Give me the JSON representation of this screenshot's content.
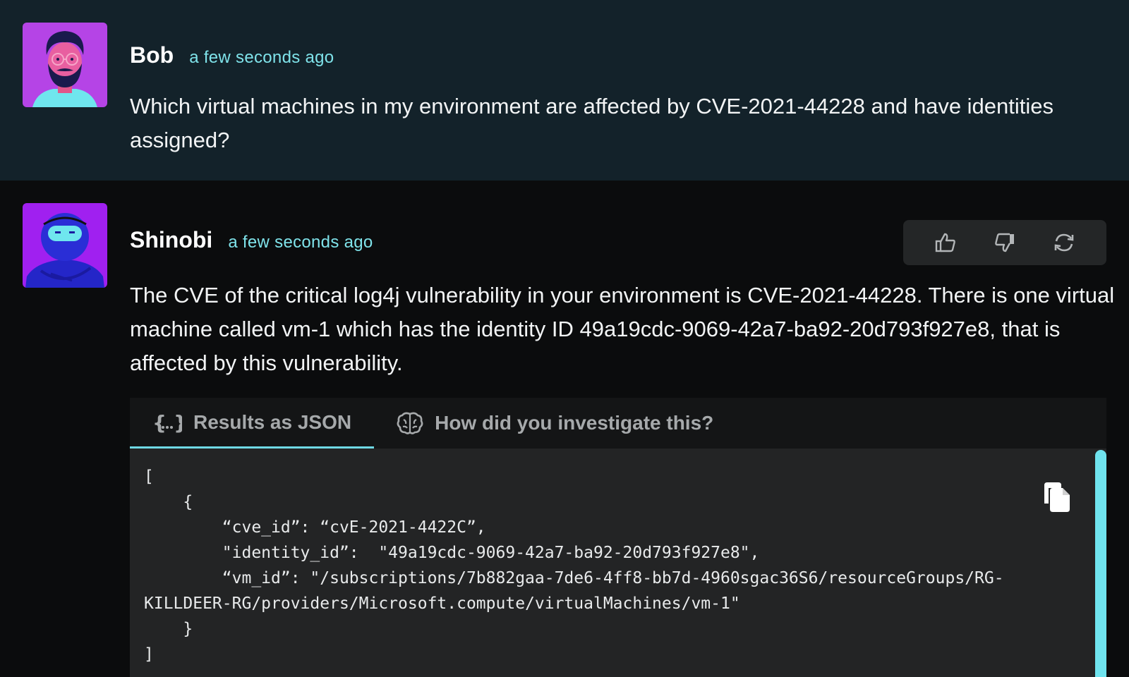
{
  "user_message": {
    "author": "Bob",
    "timestamp": "a few seconds ago",
    "text": "Which virtual machines in my environment are affected by CVE-2021-44228 and have identities assigned?",
    "avatar_icon": "bearded-man-avatar"
  },
  "bot_message": {
    "author": "Shinobi",
    "timestamp": "a few seconds ago",
    "text": "The CVE of the critical log4j vulnerability in your environment is CVE-2021-44228. There is one virtual machine called vm-1 which has the identity ID 49a19cdc-9069-42a7-ba92-20d793f927e8, that is affected by this vulnerability.",
    "avatar_icon": "ninja-avatar",
    "actions": [
      "thumbs-up-icon",
      "thumbs-down-icon",
      "refresh-icon"
    ]
  },
  "tabs": [
    {
      "label": "Results as JSON",
      "icon": "json-braces-icon",
      "active": true
    },
    {
      "label": "How did you investigate this?",
      "icon": "brain-icon",
      "active": false
    }
  ],
  "code": {
    "lines": [
      "[",
      "    {",
      "        “cve_id”: “cvE-2021-4422C”,",
      "        \"identity_id”:  \"49a19cdc-9069-42a7-ba92-20d793f927e8\",",
      "        “vm_id”: \"/subscriptions/7b882gaa-7de6-4ff8-bb7d-4960sgac36S6/resourceGroups/RG-",
      "KILLDEER-RG/providers/Microsoft.compute/virtualMachines/vm-1\"",
      "    }",
      "]"
    ]
  },
  "colors": {
    "user_bg": "#13222a",
    "bot_bg": "#0b0c0d",
    "accent": "#6fd8e4",
    "timestamp": "#7fe3ea"
  }
}
